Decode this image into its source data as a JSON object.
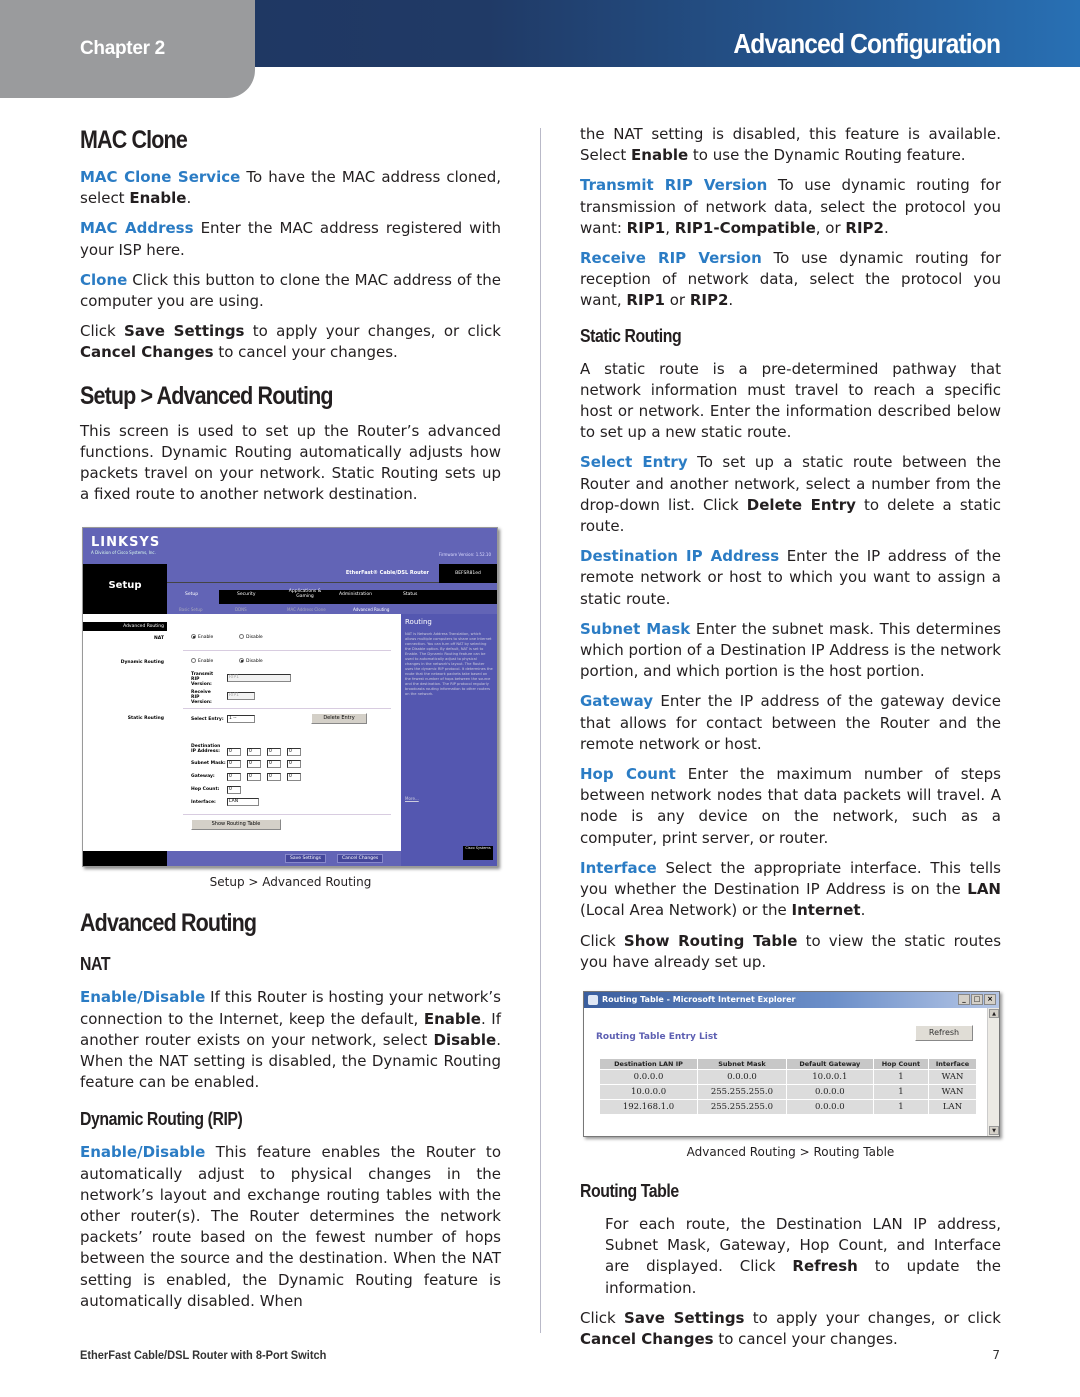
{
  "header": {
    "chapter": "Chapter 2",
    "title": "Advanced Configuration"
  },
  "left": {
    "mac_clone": {
      "heading": "MAC Clone",
      "p1": {
        "term": "MAC Clone Service",
        "text": " To have the MAC address cloned, select ",
        "b1": "Enable",
        "end": "."
      },
      "p2": {
        "term": "MAC Address",
        "text": " Enter the MAC address registered with your ISP here."
      },
      "p3": {
        "term": "Clone",
        "text": "  Click this button to clone the MAC address of the computer you are using."
      },
      "p4": {
        "pre": "Click ",
        "b1": "Save Settings",
        "mid": " to apply your changes, or click ",
        "b2": "Cancel Changes",
        "end": " to cancel your changes."
      }
    },
    "setup_adv": {
      "heading": "Setup > Advanced Routing",
      "p1": "This screen is used to set up the Router’s advanced functions. Dynamic Routing automatically adjusts how packets travel on your network. Static Routing sets up a fixed route to another network destination."
    },
    "screenshot": {
      "logo": "LINKSYS",
      "logo_sub": "A Division of Cisco Systems, Inc.",
      "firmware": "Firmware Version: 1.52.10",
      "section": "Setup",
      "product": "EtherFast® Cable/DSL Router",
      "model": "BEFSR81ed",
      "tabs": [
        "Setup",
        "Security",
        "Applications & Gaming",
        "Administration",
        "Status"
      ],
      "subtabs": [
        "Basic Setup",
        "DDNS",
        "MAC Address Clone",
        "Advanced Routing"
      ],
      "left_bar": "Advanced Routing",
      "labels": {
        "nat": "NAT",
        "dynamic": "Dynamic Routing",
        "static": "Static Routing"
      },
      "nat_options": [
        "Enable",
        "Disable"
      ],
      "nat_selected": "Enable",
      "dyn_options": [
        "Enable",
        "Disable"
      ],
      "dyn_selected": "Disable",
      "transmit_label": "Transmit RIP Version:",
      "transmit_value": "RIP1",
      "receive_label": "Receive RIP Version:",
      "receive_value": "RIP1",
      "select_entry_label": "Select Entry:",
      "select_entry_value": "1 --",
      "delete_entry": "Delete Entry",
      "dest_ip_label": "Destination IP Address:",
      "subnet_label": "Subnet Mask:",
      "gateway_label": "Gateway:",
      "hop_label": "Hop Count:",
      "interface_label": "Interface:",
      "dest_ip": [
        "0",
        "0",
        "0",
        "0"
      ],
      "subnet": [
        "0",
        "0",
        "0",
        "0"
      ],
      "gateway": [
        "0",
        "0",
        "0",
        "0"
      ],
      "hop": "0",
      "interface": "LAN",
      "show_table": "Show Routing Table",
      "save": "Save Settings",
      "cancel": "Cancel Changes",
      "help_title": "Routing",
      "help_text": "NAT is Network Address Translation, which allows multiple computers to share one Internet connection. You can turn off NAT by selecting the Disable option. By default, NAT is set to Enable. The Dynamic Routing feature can be used to automatically adjust to physical changes in the network's layout. The Router uses the dynamic RIP protocol. It determines the route that the network packets take based on the fewest number of hops between the source and the destination. The RIP protocol regularly broadcasts routing information to other routers on the network.",
      "help_more": "More...",
      "cisco": "Cisco Systems"
    },
    "caption1": "Setup > Advanced Routing",
    "adv_routing": {
      "heading": "Advanced Routing",
      "nat_heading": "NAT",
      "nat_p": {
        "term": "Enable/Disable",
        "t1": "  If this Router is hosting your network’s connection to the Internet, keep the default, ",
        "b1": "Enable",
        "t2": ". If another router exists on your network, select ",
        "b2": "Disable",
        "t3": ". When the NAT setting is disabled, the Dynamic Routing feature can be enabled."
      },
      "rip_heading": "Dynamic Routing (RIP)",
      "rip_p": {
        "term": "Enable/Disable",
        "text": " This feature enables the Router to automatically adjust to physical changes in the network’s layout and exchange routing tables with the other router(s). The Router determines the network packets’ route based on the fewest number of hops between the source and the destination. When the NAT setting is enabled, the Dynamic Routing feature is automatically disabled. When"
      }
    }
  },
  "right": {
    "cont": {
      "t1": "the NAT setting is disabled, this feature is available. Select ",
      "b1": "Enable",
      "t2": " to use the Dynamic Routing feature."
    },
    "transmit": {
      "term": "Transmit RIP Version",
      "t1": " To use dynamic routing for transmission of network data, select the protocol you want: ",
      "b1": "RIP1",
      "t2": ", ",
      "b2": "RIP1-Compatible",
      "t3": ", or ",
      "b3": "RIP2",
      "t4": "."
    },
    "receive": {
      "term": "Receive RIP Version",
      "t1": "  To use dynamic routing for reception of network data, select the protocol you want, ",
      "b1": "RIP1",
      "t2": " or ",
      "b2": "RIP2",
      "t3": "."
    },
    "static_heading": "Static Routing",
    "static_p": "A static route is a pre-determined pathway that network information must travel to reach a specific host or network. Enter the information described below to set up a new static route.",
    "select_entry": {
      "term": "Select Entry",
      "t1": "  To set up a static route between the Router and another network, select a number from the drop-down list. Click ",
      "b1": "Delete Entry",
      "t2": " to delete a static route."
    },
    "dest_ip": {
      "term": "Destination IP Address",
      "text": " Enter the IP address of the remote network or host to which you want to assign a static route."
    },
    "subnet": {
      "term": "Subnet Mask",
      "text": " Enter the subnet mask. This determines which portion of a Destination IP Address is the network portion, and which portion is the host portion."
    },
    "gateway": {
      "term": "Gateway",
      "text": "  Enter the IP address of the gateway device that allows for contact between the Router and the remote network or host."
    },
    "hop": {
      "term": "Hop Count",
      "text": "  Enter the maximum number of steps between network nodes that data packets will travel. A node is any device on the network, such as a computer, print server, or router."
    },
    "interface": {
      "term": "Interface",
      "t1": "  Select the appropriate interface. This tells you whether the Destination IP Address is on the ",
      "b1": "LAN",
      "t2": " (Local Area Network) or the ",
      "b2": "Internet",
      "t3": "."
    },
    "show_table": {
      "t1": "Click ",
      "b1": "Show Routing Table",
      "t2": " to view the static routes you have already set up."
    },
    "rt_window": {
      "title": "Routing Table - Microsoft Internet Explorer",
      "heading": "Routing Table Entry List",
      "refresh": "Refresh",
      "columns": [
        "Destination LAN IP",
        "Subnet Mask",
        "Default Gateway",
        "Hop Count",
        "Interface"
      ],
      "rows": [
        [
          "0.0.0.0",
          "0.0.0.0",
          "10.0.0.1",
          "1",
          "WAN"
        ],
        [
          "10.0.0.0",
          "255.255.255.0",
          "0.0.0.0",
          "1",
          "WAN"
        ],
        [
          "192.168.1.0",
          "255.255.255.0",
          "0.0.0.0",
          "1",
          "LAN"
        ]
      ]
    },
    "caption2": "Advanced Routing > Routing Table",
    "rt_heading": "Routing Table",
    "rt_p": {
      "t1": "For each route, the Destination LAN IP address, Subnet Mask, Gateway, Hop Count, and Interface are displayed. Click  ",
      "b1": "Refresh",
      "t2": " to update the information."
    },
    "final": {
      "pre": "Click ",
      "b1": "Save Settings",
      "mid": " to apply your changes, or click ",
      "b2": "Cancel Changes",
      "end": " to cancel your changes."
    }
  },
  "footer": {
    "product": "EtherFast Cable/DSL Router with 8-Port Switch",
    "page": "7"
  },
  "colors": {
    "term_blue": "#2b7cc4",
    "header_dark": "#1e3560",
    "header_light": "#2870b4",
    "chapter_gray": "#9a9b9d",
    "linksys_purple": "#6264b6"
  }
}
